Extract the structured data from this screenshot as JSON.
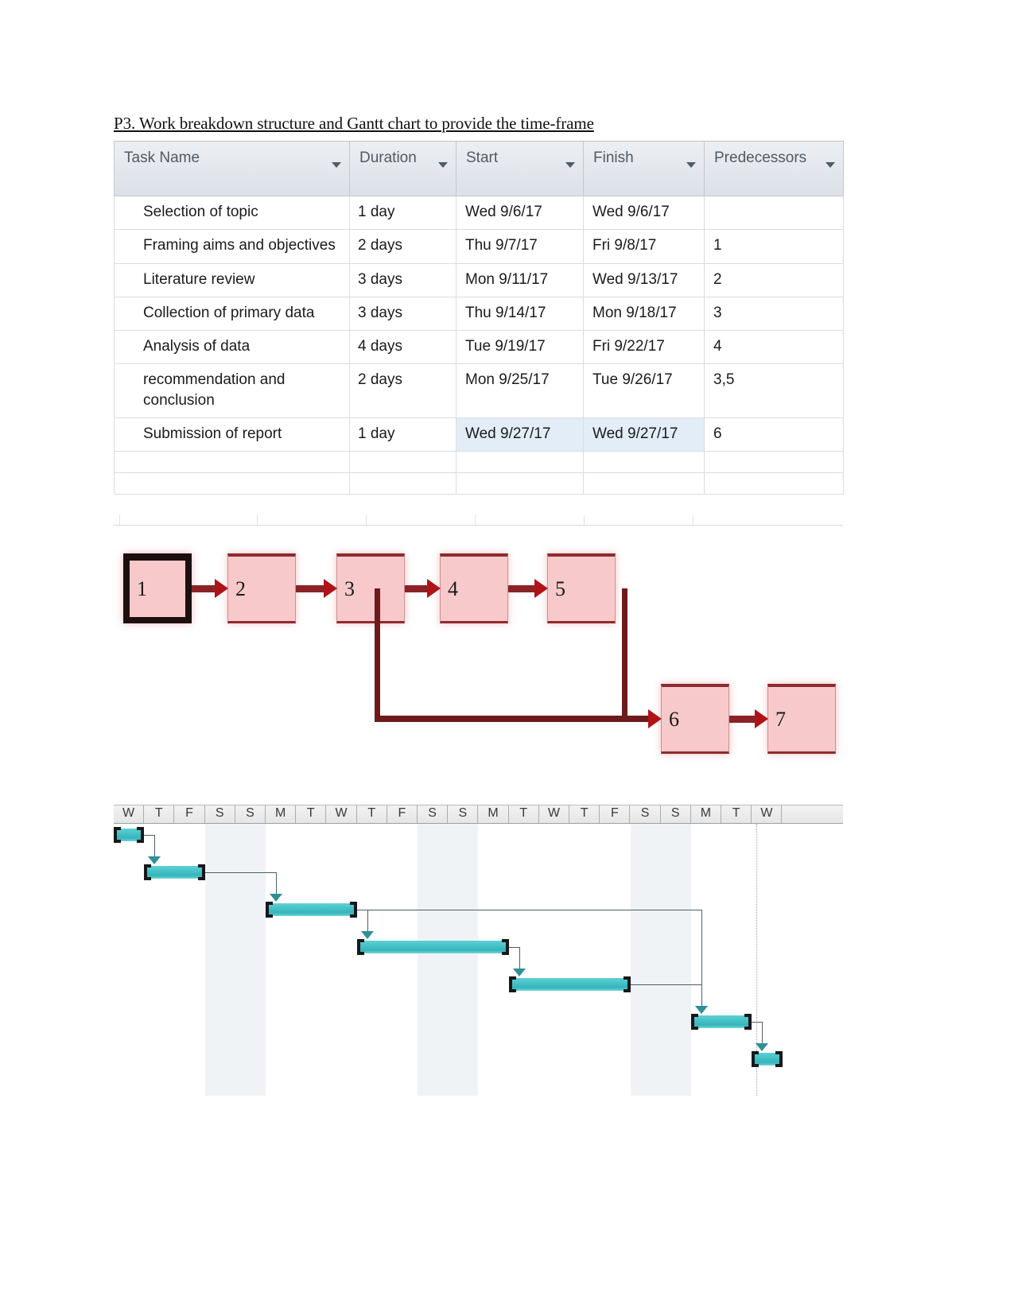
{
  "heading": "P3. Work breakdown structure and Gantt chart to provide the time-frame",
  "table": {
    "columns": [
      {
        "label": "Task Name",
        "filter_icon": "filter-dropdown-arrow-icon"
      },
      {
        "label": "Duration",
        "filter_icon": "filter-dropdown-arrow-icon"
      },
      {
        "label": "Start",
        "filter_icon": "filter-dropdown-arrow-icon"
      },
      {
        "label": "Finish",
        "filter_icon": "filter-dropdown-arrow-icon"
      },
      {
        "label": "Predecessors",
        "filter_icon": "filter-dropdown-arrow-icon"
      }
    ],
    "rows": [
      {
        "id": 1,
        "name": "Selection of topic",
        "duration": "1 day",
        "start": "Wed 9/6/17",
        "finish": "Wed 9/6/17",
        "predecessors": "",
        "selected": false
      },
      {
        "id": 2,
        "name": "Framing aims and objectives",
        "duration": "2 days",
        "start": "Thu 9/7/17",
        "finish": "Fri 9/8/17",
        "predecessors": "1",
        "selected": false
      },
      {
        "id": 3,
        "name": "Literature review",
        "duration": "3 days",
        "start": "Mon 9/11/17",
        "finish": "Wed 9/13/17",
        "predecessors": "2",
        "selected": false
      },
      {
        "id": 4,
        "name": "Collection of primary data",
        "duration": "3 days",
        "start": "Thu 9/14/17",
        "finish": "Mon 9/18/17",
        "predecessors": "3",
        "selected": false
      },
      {
        "id": 5,
        "name": "Analysis of data",
        "duration": "4 days",
        "start": "Tue 9/19/17",
        "finish": "Fri 9/22/17",
        "predecessors": "4",
        "selected": false
      },
      {
        "id": 6,
        "name": "recommendation and conclusion",
        "duration": "2 days",
        "start": "Mon 9/25/17",
        "finish": "Tue 9/26/17",
        "predecessors": "3,5",
        "selected": false
      },
      {
        "id": 7,
        "name": "Submission of report",
        "duration": "1 day",
        "start": "Wed 9/27/17",
        "finish": "Wed 9/27/17",
        "predecessors": "6",
        "selected": true
      }
    ]
  },
  "network_diagram": {
    "node_fill_color": "#f7c9cb",
    "node_border_color": "#8f2b2e",
    "arrow_color": "#8b2326",
    "nodes": [
      {
        "label": "1",
        "is_start": true
      },
      {
        "label": "2",
        "is_start": false
      },
      {
        "label": "3",
        "is_start": false
      },
      {
        "label": "4",
        "is_start": false
      },
      {
        "label": "5",
        "is_start": false
      },
      {
        "label": "6",
        "is_start": false
      },
      {
        "label": "7",
        "is_start": false
      }
    ],
    "links": [
      "1-2",
      "2-3",
      "3-4",
      "4-5",
      "3-6",
      "5-6",
      "6-7"
    ]
  },
  "chart_data": {
    "type": "bar",
    "title": "",
    "xlabel": "",
    "ylabel": "",
    "bar_color": "#49c4c9",
    "timescale_labels": [
      "W",
      "T",
      "F",
      "S",
      "S",
      "M",
      "T",
      "W",
      "T",
      "F",
      "S",
      "S",
      "M",
      "T",
      "W",
      "T",
      "F",
      "S",
      "S",
      "M",
      "T",
      "W"
    ],
    "weekend_label": "S",
    "tasks": [
      {
        "name": "Selection of topic",
        "duration_days": 1,
        "start": "Wed 9/6/17",
        "finish": "Wed 9/6/17",
        "start_index": 0,
        "span": 1
      },
      {
        "name": "Framing aims and objectives",
        "duration_days": 2,
        "start": "Thu 9/7/17",
        "finish": "Fri 9/8/17",
        "start_index": 1,
        "span": 2
      },
      {
        "name": "Literature review",
        "duration_days": 3,
        "start": "Mon 9/11/17",
        "finish": "Wed 9/13/17",
        "start_index": 5,
        "span": 3
      },
      {
        "name": "Collection of primary data",
        "duration_days": 3,
        "start": "Thu 9/14/17",
        "finish": "Mon 9/18/17",
        "start_index": 8,
        "span": 5
      },
      {
        "name": "Analysis of data",
        "duration_days": 4,
        "start": "Tue 9/19/17",
        "finish": "Fri 9/22/17",
        "start_index": 13,
        "span": 4
      },
      {
        "name": "recommendation and conclusion",
        "duration_days": 2,
        "start": "Mon 9/25/17",
        "finish": "Tue 9/26/17",
        "start_index": 19,
        "span": 2
      },
      {
        "name": "Submission of report",
        "duration_days": 1,
        "start": "Wed 9/27/17",
        "finish": "Wed 9/27/17",
        "start_index": 21,
        "span": 1
      }
    ]
  }
}
